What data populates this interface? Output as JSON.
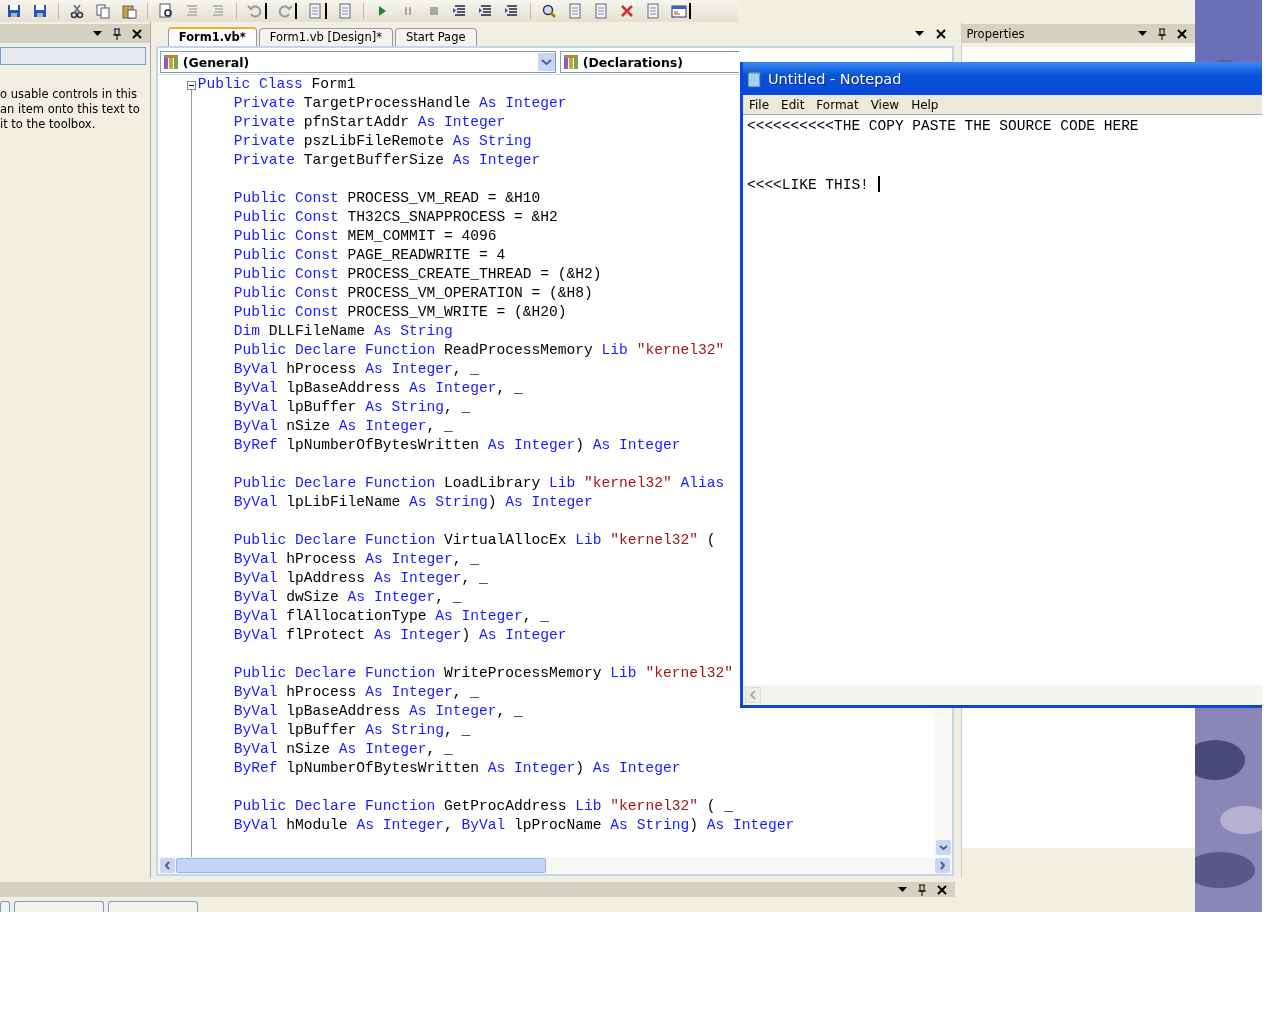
{
  "toolbox": {
    "text_lines": [
      "o usable controls in this",
      "an item onto this text to",
      "it to the toolbox."
    ]
  },
  "editor": {
    "tabs": [
      {
        "label": "Form1.vb*",
        "selected": true
      },
      {
        "label": "Form1.vb [Design]*",
        "selected": false
      },
      {
        "label": "Start Page",
        "selected": false
      }
    ],
    "class_dropdown": "(General)",
    "method_dropdown": "(Declarations)",
    "code": {
      "header": [
        {
          "kind": "keyword",
          "text": "Public Class"
        },
        {
          "kind": "plain",
          "text": " Form1"
        }
      ],
      "expanded": true,
      "blocks": [
        [
          [
            {
              "kind": "keyword",
              "text": "Private"
            },
            {
              "kind": "plain",
              "text": " TargetProcessHandle "
            },
            {
              "kind": "keyword",
              "text": "As Integer"
            }
          ],
          [
            {
              "kind": "keyword",
              "text": "Private"
            },
            {
              "kind": "plain",
              "text": " pfnStartAddr "
            },
            {
              "kind": "keyword",
              "text": "As Integer"
            }
          ],
          [
            {
              "kind": "keyword",
              "text": "Private"
            },
            {
              "kind": "plain",
              "text": " pszLibFileRemote "
            },
            {
              "kind": "keyword",
              "text": "As String"
            }
          ],
          [
            {
              "kind": "keyword",
              "text": "Private"
            },
            {
              "kind": "plain",
              "text": " TargetBufferSize "
            },
            {
              "kind": "keyword",
              "text": "As Integer"
            }
          ]
        ],
        [
          [
            {
              "kind": "keyword",
              "text": "Public Const"
            },
            {
              "kind": "plain",
              "text": " PROCESS_VM_READ = &H10"
            }
          ],
          [
            {
              "kind": "keyword",
              "text": "Public Const"
            },
            {
              "kind": "plain",
              "text": " TH32CS_SNAPPROCESS = &H2"
            }
          ],
          [
            {
              "kind": "keyword",
              "text": "Public Const"
            },
            {
              "kind": "plain",
              "text": " MEM_COMMIT = 4096"
            }
          ],
          [
            {
              "kind": "keyword",
              "text": "Public Const"
            },
            {
              "kind": "plain",
              "text": " PAGE_READWRITE = 4"
            }
          ],
          [
            {
              "kind": "keyword",
              "text": "Public Const"
            },
            {
              "kind": "plain",
              "text": " PROCESS_CREATE_THREAD = (&H2)"
            }
          ],
          [
            {
              "kind": "keyword",
              "text": "Public Const"
            },
            {
              "kind": "plain",
              "text": " PROCESS_VM_OPERATION = (&H8)"
            }
          ],
          [
            {
              "kind": "keyword",
              "text": "Public Const"
            },
            {
              "kind": "plain",
              "text": " PROCESS_VM_WRITE = (&H20)"
            }
          ],
          [
            {
              "kind": "keyword",
              "text": "Dim"
            },
            {
              "kind": "plain",
              "text": " DLLFileName "
            },
            {
              "kind": "keyword",
              "text": "As String"
            }
          ],
          [
            {
              "kind": "keyword",
              "text": "Public Declare Function"
            },
            {
              "kind": "plain",
              "text": " ReadProcessMemory "
            },
            {
              "kind": "keyword",
              "text": "Lib"
            },
            {
              "kind": "string",
              "text": " \"kernel32\""
            }
          ],
          [
            {
              "kind": "keyword",
              "text": "ByVal"
            },
            {
              "kind": "plain",
              "text": " hProcess "
            },
            {
              "kind": "keyword",
              "text": "As Integer"
            },
            {
              "kind": "plain",
              "text": ", _"
            }
          ],
          [
            {
              "kind": "keyword",
              "text": "ByVal"
            },
            {
              "kind": "plain",
              "text": " lpBaseAddress "
            },
            {
              "kind": "keyword",
              "text": "As Integer"
            },
            {
              "kind": "plain",
              "text": ", _"
            }
          ],
          [
            {
              "kind": "keyword",
              "text": "ByVal"
            },
            {
              "kind": "plain",
              "text": " lpBuffer "
            },
            {
              "kind": "keyword",
              "text": "As String"
            },
            {
              "kind": "plain",
              "text": ", _"
            }
          ],
          [
            {
              "kind": "keyword",
              "text": "ByVal"
            },
            {
              "kind": "plain",
              "text": " nSize "
            },
            {
              "kind": "keyword",
              "text": "As Integer"
            },
            {
              "kind": "plain",
              "text": ", _"
            }
          ],
          [
            {
              "kind": "keyword",
              "text": "ByRef"
            },
            {
              "kind": "plain",
              "text": " lpNumberOfBytesWritten "
            },
            {
              "kind": "keyword",
              "text": "As Integer"
            },
            {
              "kind": "plain",
              "text": ") "
            },
            {
              "kind": "keyword",
              "text": "As Integer"
            }
          ]
        ],
        [
          [
            {
              "kind": "keyword",
              "text": "Public Declare Function"
            },
            {
              "kind": "plain",
              "text": " LoadLibrary "
            },
            {
              "kind": "keyword",
              "text": "Lib"
            },
            {
              "kind": "string",
              "text": " \"kernel32\""
            },
            {
              "kind": "keyword",
              "text": " Alias"
            }
          ],
          [
            {
              "kind": "keyword",
              "text": "ByVal"
            },
            {
              "kind": "plain",
              "text": " lpLibFileName "
            },
            {
              "kind": "keyword",
              "text": "As String"
            },
            {
              "kind": "plain",
              "text": ") "
            },
            {
              "kind": "keyword",
              "text": "As Integer"
            }
          ]
        ],
        [
          [
            {
              "kind": "keyword",
              "text": "Public Declare Function"
            },
            {
              "kind": "plain",
              "text": " VirtualAllocEx "
            },
            {
              "kind": "keyword",
              "text": "Lib"
            },
            {
              "kind": "string",
              "text": " \"kernel32\""
            },
            {
              "kind": "plain",
              "text": " ("
            }
          ],
          [
            {
              "kind": "keyword",
              "text": "ByVal"
            },
            {
              "kind": "plain",
              "text": " hProcess "
            },
            {
              "kind": "keyword",
              "text": "As Integer"
            },
            {
              "kind": "plain",
              "text": ", _"
            }
          ],
          [
            {
              "kind": "keyword",
              "text": "ByVal"
            },
            {
              "kind": "plain",
              "text": " lpAddress "
            },
            {
              "kind": "keyword",
              "text": "As Integer"
            },
            {
              "kind": "plain",
              "text": ", _"
            }
          ],
          [
            {
              "kind": "keyword",
              "text": "ByVal"
            },
            {
              "kind": "plain",
              "text": " dwSize "
            },
            {
              "kind": "keyword",
              "text": "As Integer"
            },
            {
              "kind": "plain",
              "text": ", _"
            }
          ],
          [
            {
              "kind": "keyword",
              "text": "ByVal"
            },
            {
              "kind": "plain",
              "text": " flAllocationType "
            },
            {
              "kind": "keyword",
              "text": "As Integer"
            },
            {
              "kind": "plain",
              "text": ", _"
            }
          ],
          [
            {
              "kind": "keyword",
              "text": "ByVal"
            },
            {
              "kind": "plain",
              "text": " flProtect "
            },
            {
              "kind": "keyword",
              "text": "As Integer"
            },
            {
              "kind": "plain",
              "text": ") "
            },
            {
              "kind": "keyword",
              "text": "As Integer"
            }
          ]
        ],
        [
          [
            {
              "kind": "keyword",
              "text": "Public Declare Function"
            },
            {
              "kind": "plain",
              "text": " WriteProcessMemory "
            },
            {
              "kind": "keyword",
              "text": "Lib"
            },
            {
              "kind": "string",
              "text": " \"kernel32\""
            }
          ],
          [
            {
              "kind": "keyword",
              "text": "ByVal"
            },
            {
              "kind": "plain",
              "text": " hProcess "
            },
            {
              "kind": "keyword",
              "text": "As Integer"
            },
            {
              "kind": "plain",
              "text": ", _"
            }
          ],
          [
            {
              "kind": "keyword",
              "text": "ByVal"
            },
            {
              "kind": "plain",
              "text": " lpBaseAddress "
            },
            {
              "kind": "keyword",
              "text": "As Integer"
            },
            {
              "kind": "plain",
              "text": ", _"
            }
          ],
          [
            {
              "kind": "keyword",
              "text": "ByVal"
            },
            {
              "kind": "plain",
              "text": " lpBuffer "
            },
            {
              "kind": "keyword",
              "text": "As String"
            },
            {
              "kind": "plain",
              "text": ", _"
            }
          ],
          [
            {
              "kind": "keyword",
              "text": "ByVal"
            },
            {
              "kind": "plain",
              "text": " nSize "
            },
            {
              "kind": "keyword",
              "text": "As Integer"
            },
            {
              "kind": "plain",
              "text": ", _"
            }
          ],
          [
            {
              "kind": "keyword",
              "text": "ByRef"
            },
            {
              "kind": "plain",
              "text": " lpNumberOfBytesWritten "
            },
            {
              "kind": "keyword",
              "text": "As Integer"
            },
            {
              "kind": "plain",
              "text": ") "
            },
            {
              "kind": "keyword",
              "text": "As Integer"
            }
          ]
        ],
        [
          [
            {
              "kind": "keyword",
              "text": "Public Declare Function"
            },
            {
              "kind": "plain",
              "text": " GetProcAddress "
            },
            {
              "kind": "keyword",
              "text": "Lib"
            },
            {
              "kind": "string",
              "text": " \"kernel32\""
            },
            {
              "kind": "plain",
              "text": " ( _"
            }
          ],
          [
            {
              "kind": "keyword",
              "text": "ByVal"
            },
            {
              "kind": "plain",
              "text": " hModule "
            },
            {
              "kind": "keyword",
              "text": "As Integer"
            },
            {
              "kind": "plain",
              "text": ", "
            },
            {
              "kind": "keyword",
              "text": "ByVal"
            },
            {
              "kind": "plain",
              "text": " lpProcName "
            },
            {
              "kind": "keyword",
              "text": "As String"
            },
            {
              "kind": "plain",
              "text": ") "
            },
            {
              "kind": "keyword",
              "text": "As Integer"
            }
          ]
        ]
      ]
    }
  },
  "properties": {
    "title": "Properties"
  },
  "notepad": {
    "title": "Untitled - Notepad",
    "menu": [
      "File",
      "Edit",
      "Format",
      "View",
      "Help"
    ],
    "text": "<<<<<<<<<<THE COPY PASTE THE SOURCE CODE HERE\n\n\n<<<<LIKE THIS! "
  }
}
